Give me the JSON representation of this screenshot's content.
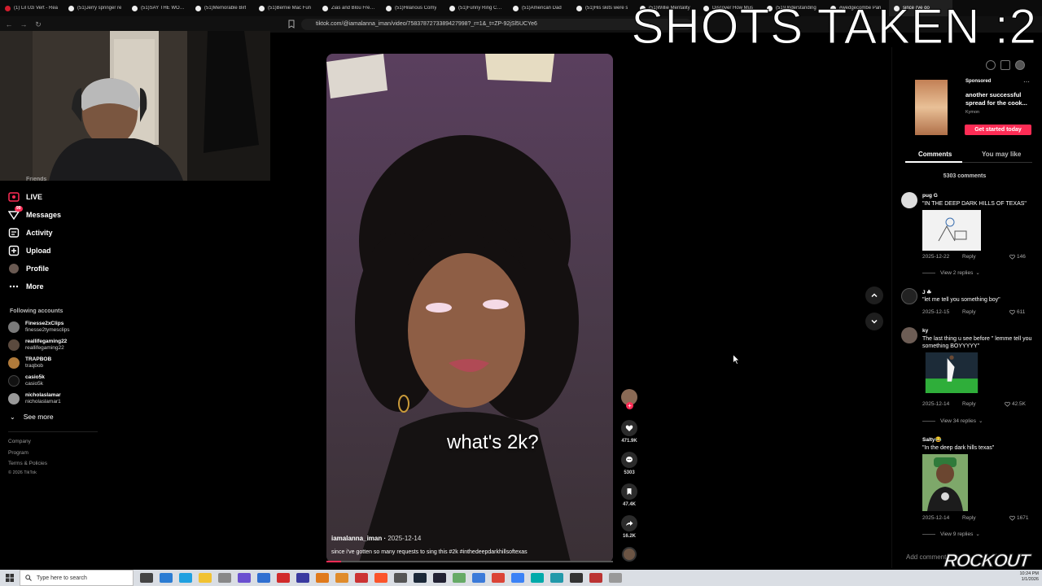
{
  "browser": {
    "tabs": [
      {
        "label": "(1) Lil Uzi Vert - Rea",
        "kind": "yt"
      },
      {
        "label": "(51)Jerry springer re",
        "kind": "tt"
      },
      {
        "label": "(51)SAY THE WORD!",
        "kind": "tt"
      },
      {
        "label": "(51)Memorable Birt",
        "kind": "tt"
      },
      {
        "label": "(51)Bernie Mac Fun",
        "kind": "tt"
      },
      {
        "label": "Zias and Blou Freest",
        "kind": "tt"
      },
      {
        "label": "(51)Hilarious Comy",
        "kind": "tt"
      },
      {
        "label": "(51)Funny Ring Cam",
        "kind": "tt"
      },
      {
        "label": "(51)American Dad",
        "kind": "tt"
      },
      {
        "label": "(51)His skits were s",
        "kind": "tt"
      },
      {
        "label": "(51)Willie Mentality",
        "kind": "tt"
      },
      {
        "label": "Discover How Mus",
        "kind": "tt"
      },
      {
        "label": "(51)Understanding",
        "kind": "tt"
      },
      {
        "label": "#wedgecombe Pari",
        "kind": "tt"
      },
      {
        "label": "since i've go",
        "kind": "tt",
        "active": true
      }
    ],
    "url": "tiktok.com/@iamalanna_iman/video/7583787273389427998?_r=1&_t=ZP-92jSl5UCYe6"
  },
  "overlay": {
    "title": "SHOTS TAKEN :2"
  },
  "sidebar": {
    "partial_top_item": "Friends",
    "items": [
      {
        "label": "LIVE",
        "icon": "live-icon"
      },
      {
        "label": "Messages",
        "icon": "messages-icon",
        "badge": "99"
      },
      {
        "label": "Activity",
        "icon": "activity-icon"
      },
      {
        "label": "Upload",
        "icon": "upload-icon"
      },
      {
        "label": "Profile",
        "icon": "profile-icon"
      },
      {
        "label": "More",
        "icon": "more-icon"
      }
    ],
    "following_title": "Following accounts",
    "accounts": [
      {
        "name": "Finesse2xClips",
        "handle": "finesse2tymesclips"
      },
      {
        "name": "reallifegaming22",
        "handle": "reallifegaming22"
      },
      {
        "name": "TRAPBOB",
        "handle": "traqbob"
      },
      {
        "name": "casio5k",
        "handle": "casio5k"
      },
      {
        "name": "nicholaslamar",
        "handle": "nicholaslamar1"
      }
    ],
    "see_more": "See more",
    "footer": {
      "company": "Company",
      "program": "Program",
      "terms": "Terms & Policies",
      "copyright": "© 2026 TikTok"
    }
  },
  "video": {
    "caption_overlay": "what's 2k?",
    "username": "iamalanna_iman",
    "date": "2025-12-14",
    "description": "since i've gotten so many requests to sing this #2k #inthedeepdarkhillsoftexas",
    "progress": 0.05,
    "likes": "471.9K",
    "comments": "5303",
    "saves": "47.4K",
    "shares": "16.2K"
  },
  "right_panel": {
    "ad": {
      "sponsored": "Sponsored",
      "text": "another successful spread for the cook...",
      "brand": "Kymon",
      "cta": "Get started today"
    },
    "tabs": {
      "comments": "Comments",
      "you_may_like": "You may like"
    },
    "comment_count": "5303 comments",
    "comments": [
      {
        "user": "pug G",
        "text": "\"IN THE DEEP DARK HILLS OF TEXAS\"",
        "date": "2025-12-22",
        "reply": "Reply",
        "likes": "146",
        "view_replies": "View 2 replies"
      },
      {
        "user": "J ☘",
        "text": "\"let me tell you something boy\"",
        "date": "2025-12-15",
        "reply": "Reply",
        "likes": "611",
        "view_replies": ""
      },
      {
        "user": "ky",
        "text": "The last thing u see before \" lemme tell you something BOYYYYY\"",
        "date": "2025-12-14",
        "reply": "Reply",
        "likes": "42.5K",
        "view_replies": "View 34 replies"
      },
      {
        "user": "Salty😂",
        "text": "\"In the deep dark hills texas\"",
        "date": "2025-12-14",
        "reply": "Reply",
        "likes": "1671",
        "view_replies": "View 9 replies"
      }
    ],
    "add_comment_placeholder": "Add comment",
    "watermark": "ROCKOUT"
  },
  "taskbar": {
    "search_placeholder": "Type here to search",
    "time": "10:24 PM",
    "date": "1/1/2026"
  },
  "colors": {
    "accent": "#fe2c55",
    "background": "#000000"
  }
}
